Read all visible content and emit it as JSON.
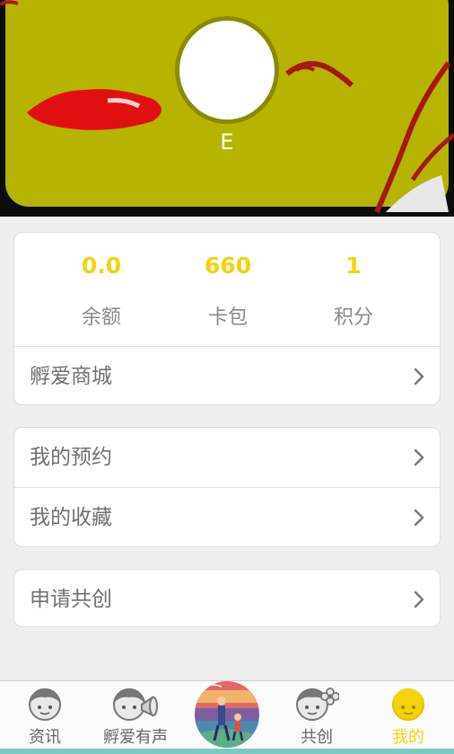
{
  "profile": {
    "name": "E"
  },
  "stats": [
    {
      "value": "0.0",
      "label": "余额"
    },
    {
      "value": "660",
      "label": "卡包"
    },
    {
      "value": "1",
      "label": "积分"
    }
  ],
  "menu": {
    "mall": "孵爱商城",
    "appointments": "我的预约",
    "favorites": "我的收藏",
    "apply": "申请共创"
  },
  "tabs": [
    {
      "label": "资讯",
      "icon": "face-icon"
    },
    {
      "label": "孵爱有声",
      "icon": "face-megaphone-icon"
    },
    {
      "label": "",
      "icon": "center-illustration-icon"
    },
    {
      "label": "共创",
      "icon": "face-flower-icon"
    },
    {
      "label": "我的",
      "icon": "face-icon",
      "active": true
    }
  ],
  "colors": {
    "accent": "#f5d20b",
    "header_yellow": "#b7b400",
    "stripe": "#7ccac2"
  }
}
